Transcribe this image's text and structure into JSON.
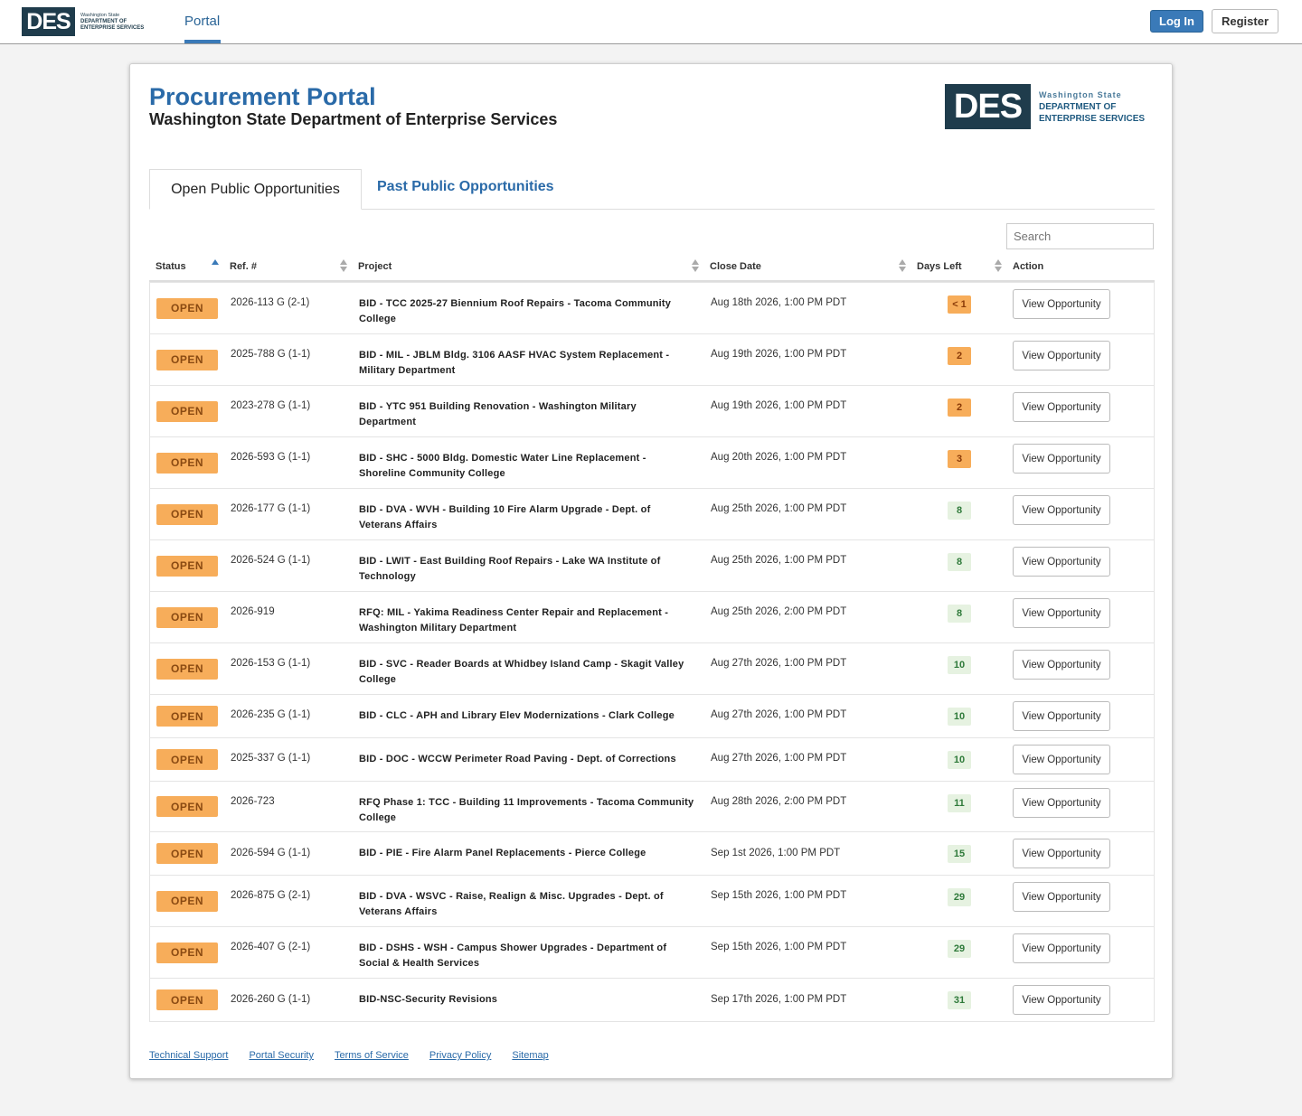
{
  "nav": {
    "logo_short": "DES",
    "logo_line1": "Washington State",
    "logo_line2": "DEPARTMENT OF",
    "logo_line3": "ENTERPRISE SERVICES",
    "tab_portal": "Portal",
    "login": "Log In",
    "register": "Register"
  },
  "header": {
    "title": "Procurement Portal",
    "subtitle": "Washington State Department of Enterprise Services"
  },
  "tabs": {
    "open": "Open Public Opportunities",
    "past": "Past Public Opportunities"
  },
  "search": {
    "placeholder": "Search"
  },
  "columns": {
    "status": "Status",
    "ref": "Ref. #",
    "project": "Project",
    "close_date": "Close Date",
    "days_left": "Days Left",
    "action": "Action"
  },
  "rows": [
    {
      "status": "OPEN",
      "ref": "2026-113 G (2-1)",
      "project": "BID - TCC 2025-27 Biennium Roof Repairs - Tacoma Community College",
      "close": "Aug 18th 2026, 1:00 PM PDT",
      "days": "< 1",
      "days_status": "warn",
      "action": "View Opportunity"
    },
    {
      "status": "OPEN",
      "ref": "2025-788 G (1-1)",
      "project": "BID - MIL - JBLM Bldg. 3106 AASF HVAC System Replacement - Military Department",
      "close": "Aug 19th 2026, 1:00 PM PDT",
      "days": "2",
      "days_status": "warn",
      "action": "View Opportunity"
    },
    {
      "status": "OPEN",
      "ref": "2023-278 G (1-1)",
      "project": "BID - YTC 951 Building Renovation - Washington Military Department",
      "close": "Aug 19th 2026, 1:00 PM PDT",
      "days": "2",
      "days_status": "warn",
      "action": "View Opportunity"
    },
    {
      "status": "OPEN",
      "ref": "2026-593 G (1-1)",
      "project": "BID - SHC - 5000 Bldg. Domestic Water Line Replacement - Shoreline Community College",
      "close": "Aug 20th 2026, 1:00 PM PDT",
      "days": "3",
      "days_status": "warn",
      "action": "View Opportunity"
    },
    {
      "status": "OPEN",
      "ref": "2026-177 G (1-1)",
      "project": "BID - DVA - WVH - Building 10 Fire Alarm Upgrade - Dept. of Veterans Affairs",
      "close": "Aug 25th 2026, 1:00 PM PDT",
      "days": "8",
      "days_status": "ok",
      "action": "View Opportunity"
    },
    {
      "status": "OPEN",
      "ref": "2026-524 G (1-1)",
      "project": "BID - LWIT - East Building Roof Repairs - Lake WA Institute of Technology",
      "close": "Aug 25th 2026, 1:00 PM PDT",
      "days": "8",
      "days_status": "ok",
      "action": "View Opportunity"
    },
    {
      "status": "OPEN",
      "ref": "2026-919",
      "project": "RFQ: MIL - Yakima Readiness Center Repair and Replacement - Washington Military Department",
      "close": "Aug 25th 2026, 2:00 PM PDT",
      "days": "8",
      "days_status": "ok",
      "action": "View Opportunity"
    },
    {
      "status": "OPEN",
      "ref": "2026-153 G (1-1)",
      "project": "BID - SVC - Reader Boards at Whidbey Island Camp - Skagit Valley College",
      "close": "Aug 27th 2026, 1:00 PM PDT",
      "days": "10",
      "days_status": "ok",
      "action": "View Opportunity"
    },
    {
      "status": "OPEN",
      "ref": "2026-235 G (1-1)",
      "project": "BID - CLC - APH and Library Elev Modernizations - Clark College",
      "close": "Aug 27th 2026, 1:00 PM PDT",
      "days": "10",
      "days_status": "ok",
      "action": "View Opportunity"
    },
    {
      "status": "OPEN",
      "ref": "2025-337 G (1-1)",
      "project": "BID - DOC - WCCW Perimeter Road Paving - Dept. of Corrections",
      "close": "Aug 27th 2026, 1:00 PM PDT",
      "days": "10",
      "days_status": "ok",
      "action": "View Opportunity"
    },
    {
      "status": "OPEN",
      "ref": "2026-723",
      "project": "RFQ Phase 1: TCC - Building 11 Improvements - Tacoma Community College",
      "close": "Aug 28th 2026, 2:00 PM PDT",
      "days": "11",
      "days_status": "ok",
      "action": "View Opportunity"
    },
    {
      "status": "OPEN",
      "ref": "2026-594 G (1-1)",
      "project": "BID - PIE - Fire Alarm Panel Replacements - Pierce College",
      "close": "Sep 1st 2026, 1:00 PM PDT",
      "days": "15",
      "days_status": "ok",
      "action": "View Opportunity"
    },
    {
      "status": "OPEN",
      "ref": "2026-875 G (2-1)",
      "project": "BID - DVA - WSVC - Raise, Realign & Misc. Upgrades - Dept. of Veterans Affairs",
      "close": "Sep 15th 2026, 1:00 PM PDT",
      "days": "29",
      "days_status": "ok",
      "action": "View Opportunity"
    },
    {
      "status": "OPEN",
      "ref": "2026-407 G (2-1)",
      "project": "BID - DSHS - WSH - Campus Shower Upgrades - Department of Social & Health Services",
      "close": "Sep 15th 2026, 1:00 PM PDT",
      "days": "29",
      "days_status": "ok",
      "action": "View Opportunity"
    },
    {
      "status": "OPEN",
      "ref": "2026-260 G (1-1)",
      "project": "BID-NSC-Security Revisions",
      "close": "Sep 17th 2026, 1:00 PM PDT",
      "days": "31",
      "days_status": "ok",
      "action": "View Opportunity"
    }
  ],
  "footer": {
    "links": [
      "Technical Support",
      "Portal Security",
      "Terms of Service",
      "Privacy Policy",
      "Sitemap"
    ]
  },
  "colors": {
    "accent": "#2a6aa8",
    "open_badge": "#f7ad5a",
    "days_ok": "#e6f2e1",
    "logo_bg": "#1f3c4c"
  }
}
